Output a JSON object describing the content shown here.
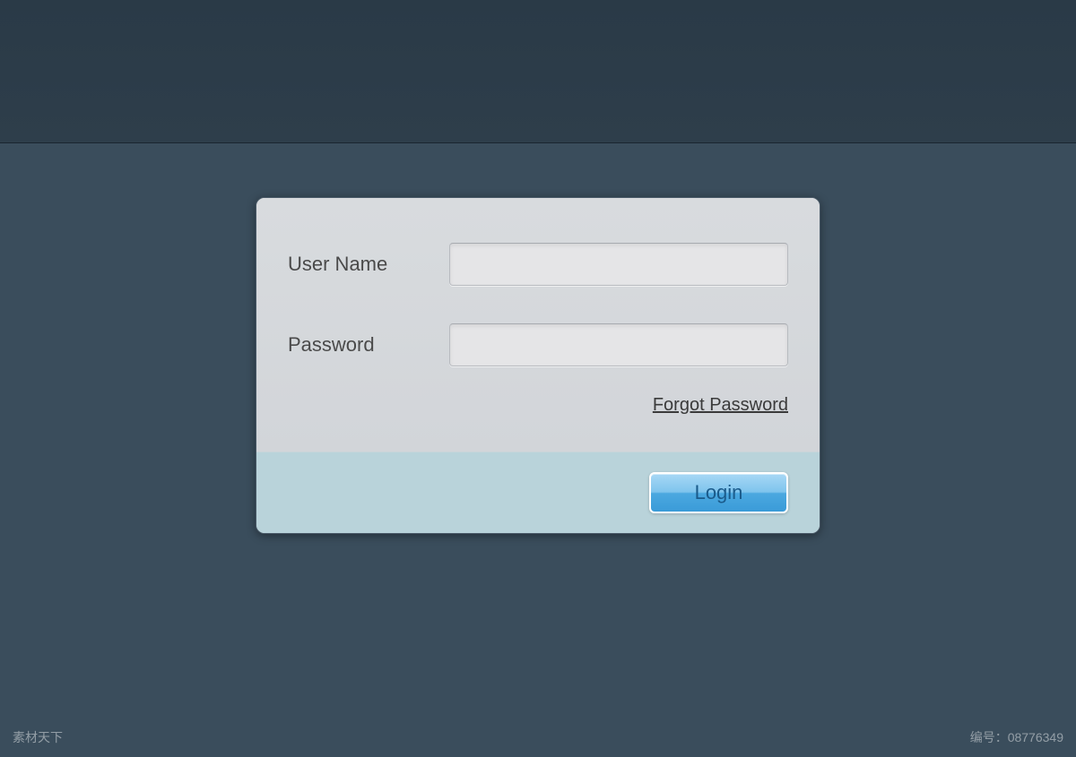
{
  "form": {
    "username_label": "User Name",
    "username_value": "",
    "password_label": "Password",
    "password_value": "",
    "forgot_label": "Forgot Password",
    "login_button_label": "Login"
  },
  "watermark": {
    "left": "素材天下",
    "right": "编号：08776349"
  }
}
